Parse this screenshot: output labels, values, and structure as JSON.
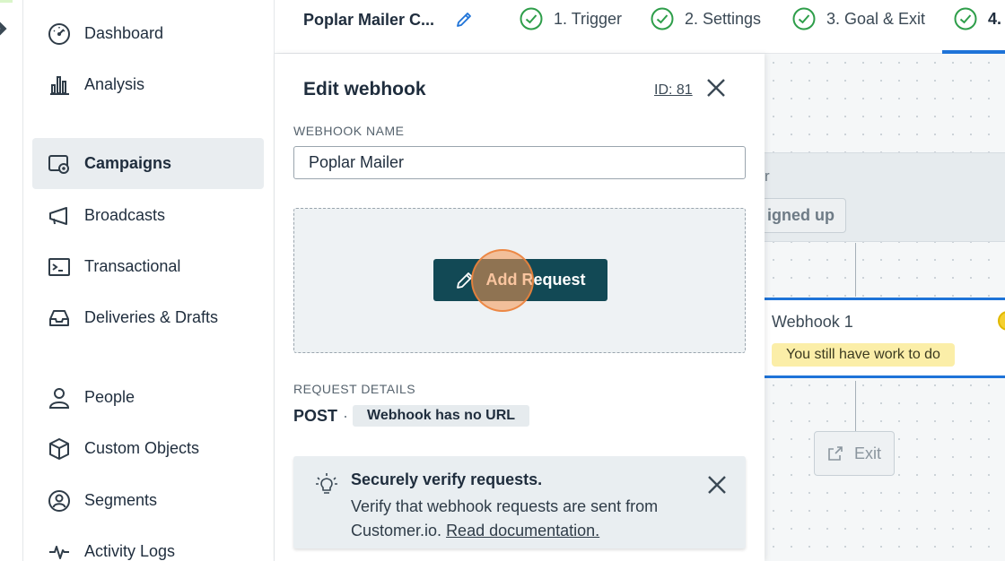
{
  "sidebar": {
    "items": [
      {
        "label": "Dashboard",
        "icon": "gauge-icon"
      },
      {
        "label": "Analysis",
        "icon": "bar-chart-icon"
      },
      {
        "label": "Campaigns",
        "icon": "campaigns-icon",
        "active": true
      },
      {
        "label": "Broadcasts",
        "icon": "megaphone-icon"
      },
      {
        "label": "Transactional",
        "icon": "terminal-icon"
      },
      {
        "label": "Deliveries & Drafts",
        "icon": "inbox-icon"
      },
      {
        "label": "People",
        "icon": "person-icon"
      },
      {
        "label": "Custom Objects",
        "icon": "cube-icon"
      },
      {
        "label": "Segments",
        "icon": "segments-icon"
      },
      {
        "label": "Activity Logs",
        "icon": "pulse-icon"
      }
    ]
  },
  "topbar": {
    "campaign_name": "Poplar Mailer C...",
    "steps": [
      {
        "label": "1. Trigger"
      },
      {
        "label": "2. Settings"
      },
      {
        "label": "3. Goal & Exit"
      },
      {
        "label": "4."
      }
    ]
  },
  "panel": {
    "title": "Edit webhook",
    "id_label": "ID: 81",
    "name_label": "WEBHOOK NAME",
    "name_value": "Poplar Mailer",
    "add_request_label": "Add Request",
    "request_details_label": "REQUEST DETAILS",
    "method": "POST",
    "separator": "·",
    "url_status": "Webhook has no URL",
    "notice": {
      "title": "Securely verify requests.",
      "body": "Verify that webhook requests are sent from Customer.io.",
      "link": "Read documentation."
    }
  },
  "canvas": {
    "trigger_title": "r",
    "trigger_pill": "igned up",
    "webhook_title": "Webhook 1",
    "webhook_warning": "You still have work to do",
    "exit_label": "Exit"
  },
  "colors": {
    "primary_button": "#124955",
    "active_tab": "#1e73d8",
    "step_check": "#2e9e4a",
    "warning_bg": "#fbeea8",
    "click_ring": "#f59650"
  }
}
